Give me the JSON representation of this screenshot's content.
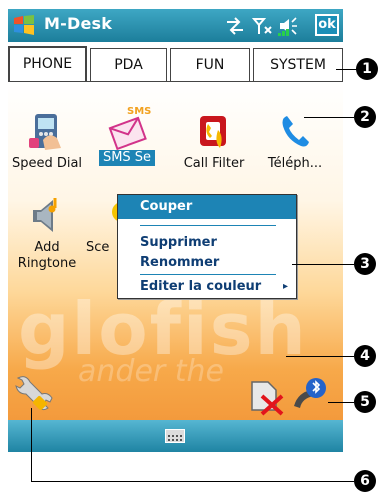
{
  "titlebar": {
    "app_title": "M-Desk",
    "ok_label": "ok"
  },
  "tabs": [
    {
      "label": "PHONE",
      "active": true
    },
    {
      "label": "PDA",
      "active": false
    },
    {
      "label": "FUN",
      "active": false
    },
    {
      "label": "SYSTEM",
      "active": false
    }
  ],
  "apps": [
    {
      "label": "Speed Dial",
      "icon": "speed-dial-icon"
    },
    {
      "label": "SMS Se",
      "icon": "sms-icon",
      "selected": true
    },
    {
      "label": "Call Filter",
      "icon": "call-filter-icon"
    },
    {
      "label": "Téléph...",
      "icon": "phone-icon"
    },
    {
      "label": "Add Ringtone",
      "icon": "ringtone-icon"
    },
    {
      "label": "Sce",
      "icon": "scene-icon"
    }
  ],
  "icon_badges": {
    "sms": "SMS"
  },
  "context_menu": {
    "items": [
      {
        "label": "Couper"
      },
      {
        "label": "Supprimer"
      },
      {
        "label": "Renommer"
      },
      {
        "label": "Editer la couleur",
        "submenu_arrow": "▸"
      }
    ]
  },
  "watermark": {
    "brand": "glofish",
    "tagline": "ander the"
  },
  "callouts": [
    "1",
    "2",
    "3",
    "4",
    "5",
    "6"
  ],
  "colors": {
    "accent": "#1d84b5",
    "titlebar": "#2a93b2",
    "content_gradient_end": "#f39a3c"
  }
}
